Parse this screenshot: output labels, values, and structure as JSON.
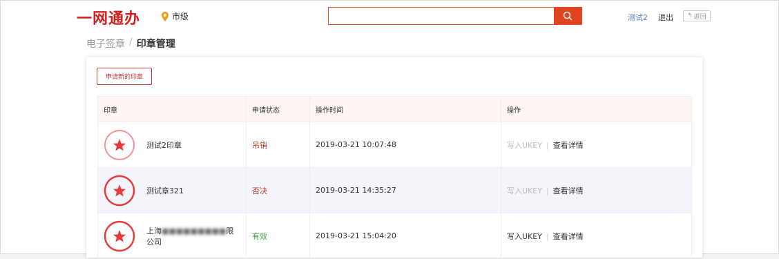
{
  "header": {
    "logo": "一网通办",
    "city": "市级",
    "search": {
      "placeholder": "",
      "value": ""
    },
    "user": "测试2",
    "logout": "退出",
    "back": "返回"
  },
  "breadcrumb": {
    "parent": "电子签章",
    "separator": "/",
    "current": "印章管理"
  },
  "apply_button": "申请新的印章",
  "table": {
    "columns": [
      "印章",
      "申请状态",
      "操作时间",
      "操作"
    ],
    "rows": [
      {
        "name": "测试2印章",
        "status": "吊销",
        "time": "2019-03-21 10:07:48",
        "write": "写入UKEY",
        "detail": "查看详情"
      },
      {
        "name": "测试章321",
        "status": "否决",
        "time": "2019-03-21 14:35:27",
        "write": "写入UKEY",
        "detail": "查看详情"
      },
      {
        "name_prefix": "上海",
        "name_suffix": "限公司",
        "status": "有效",
        "time": "2019-03-21 15:04:20",
        "write": "写入UKEY",
        "detail": "查看详情"
      }
    ]
  },
  "colors": {
    "brand": "#d41f1f",
    "search_button": "#e0431f",
    "revoked": "#c0392b",
    "valid": "#3aa63a"
  }
}
